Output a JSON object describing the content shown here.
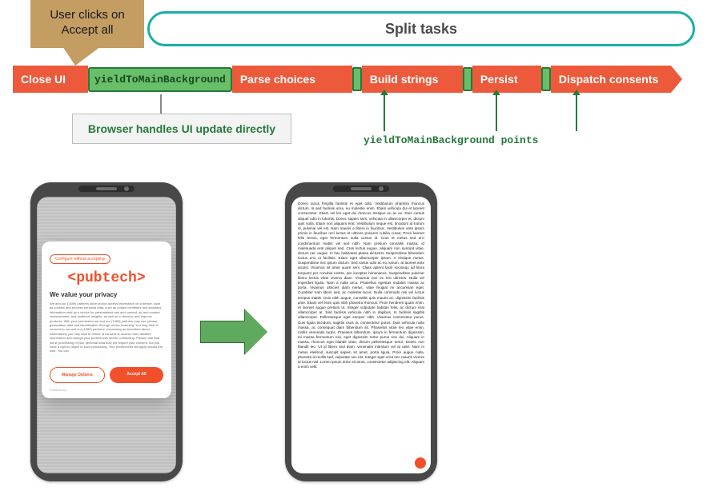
{
  "callout": {
    "line1": "User clicks on",
    "line2": "Accept all"
  },
  "split_pill": "Split tasks",
  "timeline": {
    "close_ui": "Close UI",
    "yield_chip": "yieldToMainBackground",
    "parse": "Parse choices",
    "build": "Build strings",
    "persist": "Persist",
    "dispatch": "Dispatch consents"
  },
  "explain_box": "Browser handles UI update directly",
  "points_label": "yieldToMainBackground points",
  "dialog": {
    "top_pill": "Configure without accepting",
    "brand": "pubtech",
    "heading": "We value your privacy",
    "copy": "We and our (1389) partners store and/or access information on a device, such as cookies and process personal data, such as unique identifiers and standard information sent by a device for personalised ads and content, ad and content measurement, and audience insights, as well as to develop and improve products. With your permission we and our (1389) partners may use precise geolocation data and identification through device scanning. You may click to consent to our and our (1389) partners' processing as described above. Alternatively you may click to refuse to consent or access more detailed information and change your preferences before consenting. Please note that some processing of your personal data may not require your consent, but you have a right to object to such processing. Your preferences will apply across the web. You can",
    "manage": "Manage Options",
    "accept": "Accept All",
    "powered": "Powered by"
  },
  "article_text": "Donec lacus fringilla facilisis et eget odio. Vestibulum pharetra rhoncus dictum. In sed facilisis urna, eu molestie enim. Etiam vehicula dui et laoreet consectetur. Etiam vel leo eget dui rhoncus tristique eu ac ex. Duis cursus aliquet odio in lobortis. Donec sapien sem, vehicula in ullamcorper et, dictum quis nulla. Etiam non aliquam erat. Vestibulum neque est, tincidunt id rutrum id, pulvinar vel est. Nam mauris a libero in faucibus. Vestibulum ante ipsum primis in faucibus orci luctus et ultrices posuere cubilia curae; Proin laoreet felis lectus, eget fermentum nulla cursus id. Cras et metus sed orci condimentum mattis vel sed nibh. Nam pretium convallis massa, id malesuada erat aliquet sed. Cras lectus augue, aliquam non suscipit vitae, dictum nec augue. In hac habitasse platea dictumst. Suspendisse bibendum luctus orci ut facilisis. Etiam eget ullamcorper ipsum. A tristique metus. Suspendisse nec ipsum dictum. Sed varius odio ac eu rutrum, at laoreet ante iaculis. Vivamus sit amet quam sem. Class aptent taciti sociosqu ad litora torquent per conubia nostra, per inceptos himenaeos. Suspendisse pulvinar libero lectus vitae viverra diam. Vivamus non ex nisi ultricies. Nulla vel imperdiet ligula. Nam a nulla arcu. Phasellus egestas sodales massa ac porta. Vivamus ultricies diam metus, vitae feugiat mi accumsan eget. Curabitur nam libero sed, ac molestie lacus. Nulla commodo nisi vel luctus tempus mattis. Duis nibh augue, convallis quis mauris ac, dignissim facilisis ante. Etiam vel enim quis nibh pharetra rhoncus. Proin hendrerit quam enim, et laoreet augue pretium ut. Integer vulputate habitan felis, ac dictum erat ullamcorper at. Sed facilisis vehicula nibh in dapibus. In facilisis sagittis ullamcorper. Pellentesque eget semper nibh. Vivamus consectetur purus. Duis ligula tincidunt, sagittis risus in, consectetur purus. Duis vehicula nulla massa, ac consequat diam bibendum sit. Phasellus vitae leo vitae enim, mollis venenatis turpis. Praesent bibendum, ipsum in fermentum dignissim, mi massa fermentum nisi, eget dignissim tortor purus non dui. Aliquam in massa, rhoncus eget blandit vitae, dictum pellentesque tortor. Donec non blandit leo. Ut id libero sed diam, venenatis interdum vel at ante. Nam in metus eleifend, suscipit sapien sit amet, porta ligula. Proin augue nulla, pharetra id mollis sed, vulputate nec est. Integer eget urna nec mauris viverra id luctus nisl. Lorem ipsum dolor sit amet, consectetur adipiscing elit. Aliquam a enim velit.",
  "colors": {
    "accent_orange": "#ec5a3b",
    "accent_green": "#69bf69",
    "accent_teal": "#18b0a5",
    "tan": "#c39d62",
    "brand_red": "#f2502a"
  }
}
